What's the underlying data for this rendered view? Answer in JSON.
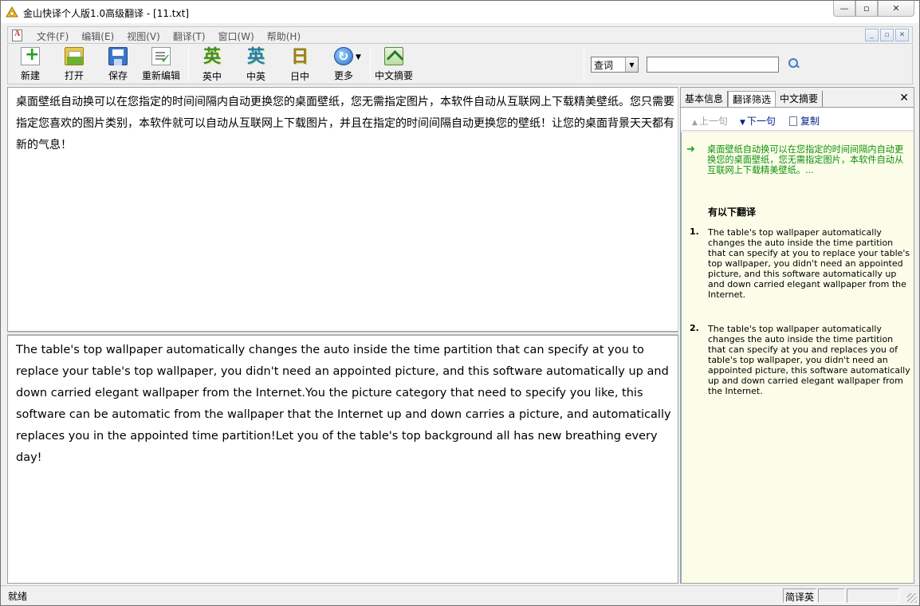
{
  "window": {
    "title": "金山快译个人版1.0高级翻译 - [11.txt]",
    "caption_buttons": {
      "minimize": "—",
      "maximize": "▫",
      "close": "✕"
    }
  },
  "menu": {
    "items": [
      "文件(F)",
      "编辑(E)",
      "视图(V)",
      "翻译(T)",
      "窗口(W)",
      "帮助(H)"
    ],
    "mdi_buttons": [
      "_",
      "▫",
      "✕"
    ]
  },
  "toolbar": {
    "buttons": [
      {
        "label": "新建",
        "icon": "new-document-icon"
      },
      {
        "label": "打开",
        "icon": "open-folder-icon"
      },
      {
        "label": "保存",
        "icon": "save-disk-icon"
      },
      {
        "label": "重新编辑",
        "icon": "re-edit-icon"
      },
      {
        "label": "英中",
        "icon": "english-to-chinese-icon",
        "glyph": "英"
      },
      {
        "label": "中英",
        "icon": "chinese-to-english-icon",
        "glyph": "英"
      },
      {
        "label": "日中",
        "icon": "japanese-to-chinese-icon",
        "glyph": "日"
      },
      {
        "label": "更多",
        "icon": "more-translate-icon"
      },
      {
        "label": "中文摘要",
        "icon": "chinese-summary-icon"
      }
    ],
    "lookup_select_value": "查词",
    "lookup_input_value": ""
  },
  "source_text": "桌面壁纸自动换可以在您指定的时间间隔内自动更换您的桌面壁纸，您无需指定图片，本软件自动从互联网上下载精美壁纸。您只需要指定您喜欢的图片类别，本软件就可以自动从互联网上下载图片，并且在指定的时间间隔自动更换您的壁纸！让您的桌面背景天天都有新的气息！",
  "target_text": "The table's top wallpaper automatically changes the auto inside the time partition that can specify at you to replace your table's top wallpaper, you didn't need an appointed picture, and this software automatically up and down carried elegant wallpaper from the Internet.You the picture category that need to specify you like, this software can be automatic from the wallpaper that the Internet up and down carries a picture, and automatically replaces you in the appointed time partition!Let you of the table's top background all has new breathing every day!",
  "side_panel": {
    "tabs": [
      "基本信息",
      "翻译筛选",
      "中文摘要"
    ],
    "active_tab": 1,
    "close": "✕",
    "prev_label": "上一句",
    "next_label": "下一句",
    "copy_label": "复制",
    "source_sentence": "桌面壁纸自动换可以在您指定的时间间隔内自动更换您的桌面壁纸，您无需指定图片，本软件自动从互联网上下载精美壁纸。...",
    "heading": "有以下翻译",
    "candidates": [
      {
        "num": "1.",
        "text": "The table's top wallpaper automatically changes the auto inside the time partition that can specify at you to replace your table's top wallpaper, you didn't need an appointed picture, and this software automatically up and down carried elegant wallpaper from the Internet."
      },
      {
        "num": "2.",
        "text": "The table's top wallpaper automatically changes the auto inside the time partition that can specify at you and replaces you of table's top wallpaper, you didn't need an appointed picture, this software automatically up and down carried elegant wallpaper from the Internet."
      }
    ]
  },
  "status": {
    "text": "就绪",
    "mode": "简译英",
    "cell2": "",
    "cell3": ""
  }
}
